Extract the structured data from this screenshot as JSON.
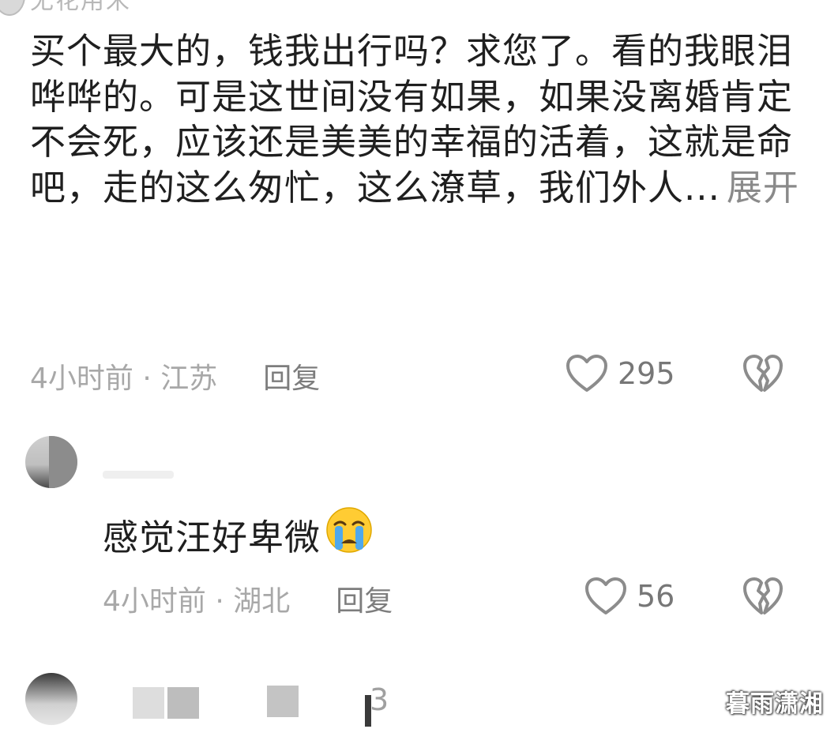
{
  "comment1": {
    "username": "无花用米",
    "text": "买个最大的，钱我出行吗？求您了。看的我眼泪哗哗的。可是这世间没有如果，如果没离婚肯定不会死，应该还是美美的幸福的活着，这就是命吧，走的这么匆忙，这么潦草，我们外人...",
    "expand_label": "展开",
    "time_location": "4小时前 · 江苏",
    "reply_label": "回复",
    "like_count": "295"
  },
  "comment2": {
    "text": "感觉汪好卑微",
    "emoji": "loudly-crying-face",
    "time_location": "4小时前 · 湖北",
    "reply_label": "回复",
    "like_count": "56"
  },
  "comment3": {
    "partial_count": "3"
  },
  "watermark": "暮雨潇湘",
  "colors": {
    "text_primary": "#1f1f1f",
    "text_meta": "#a8a8a8",
    "reply_link": "#7d7d7d",
    "icon_gray": "#8c8c8c"
  }
}
